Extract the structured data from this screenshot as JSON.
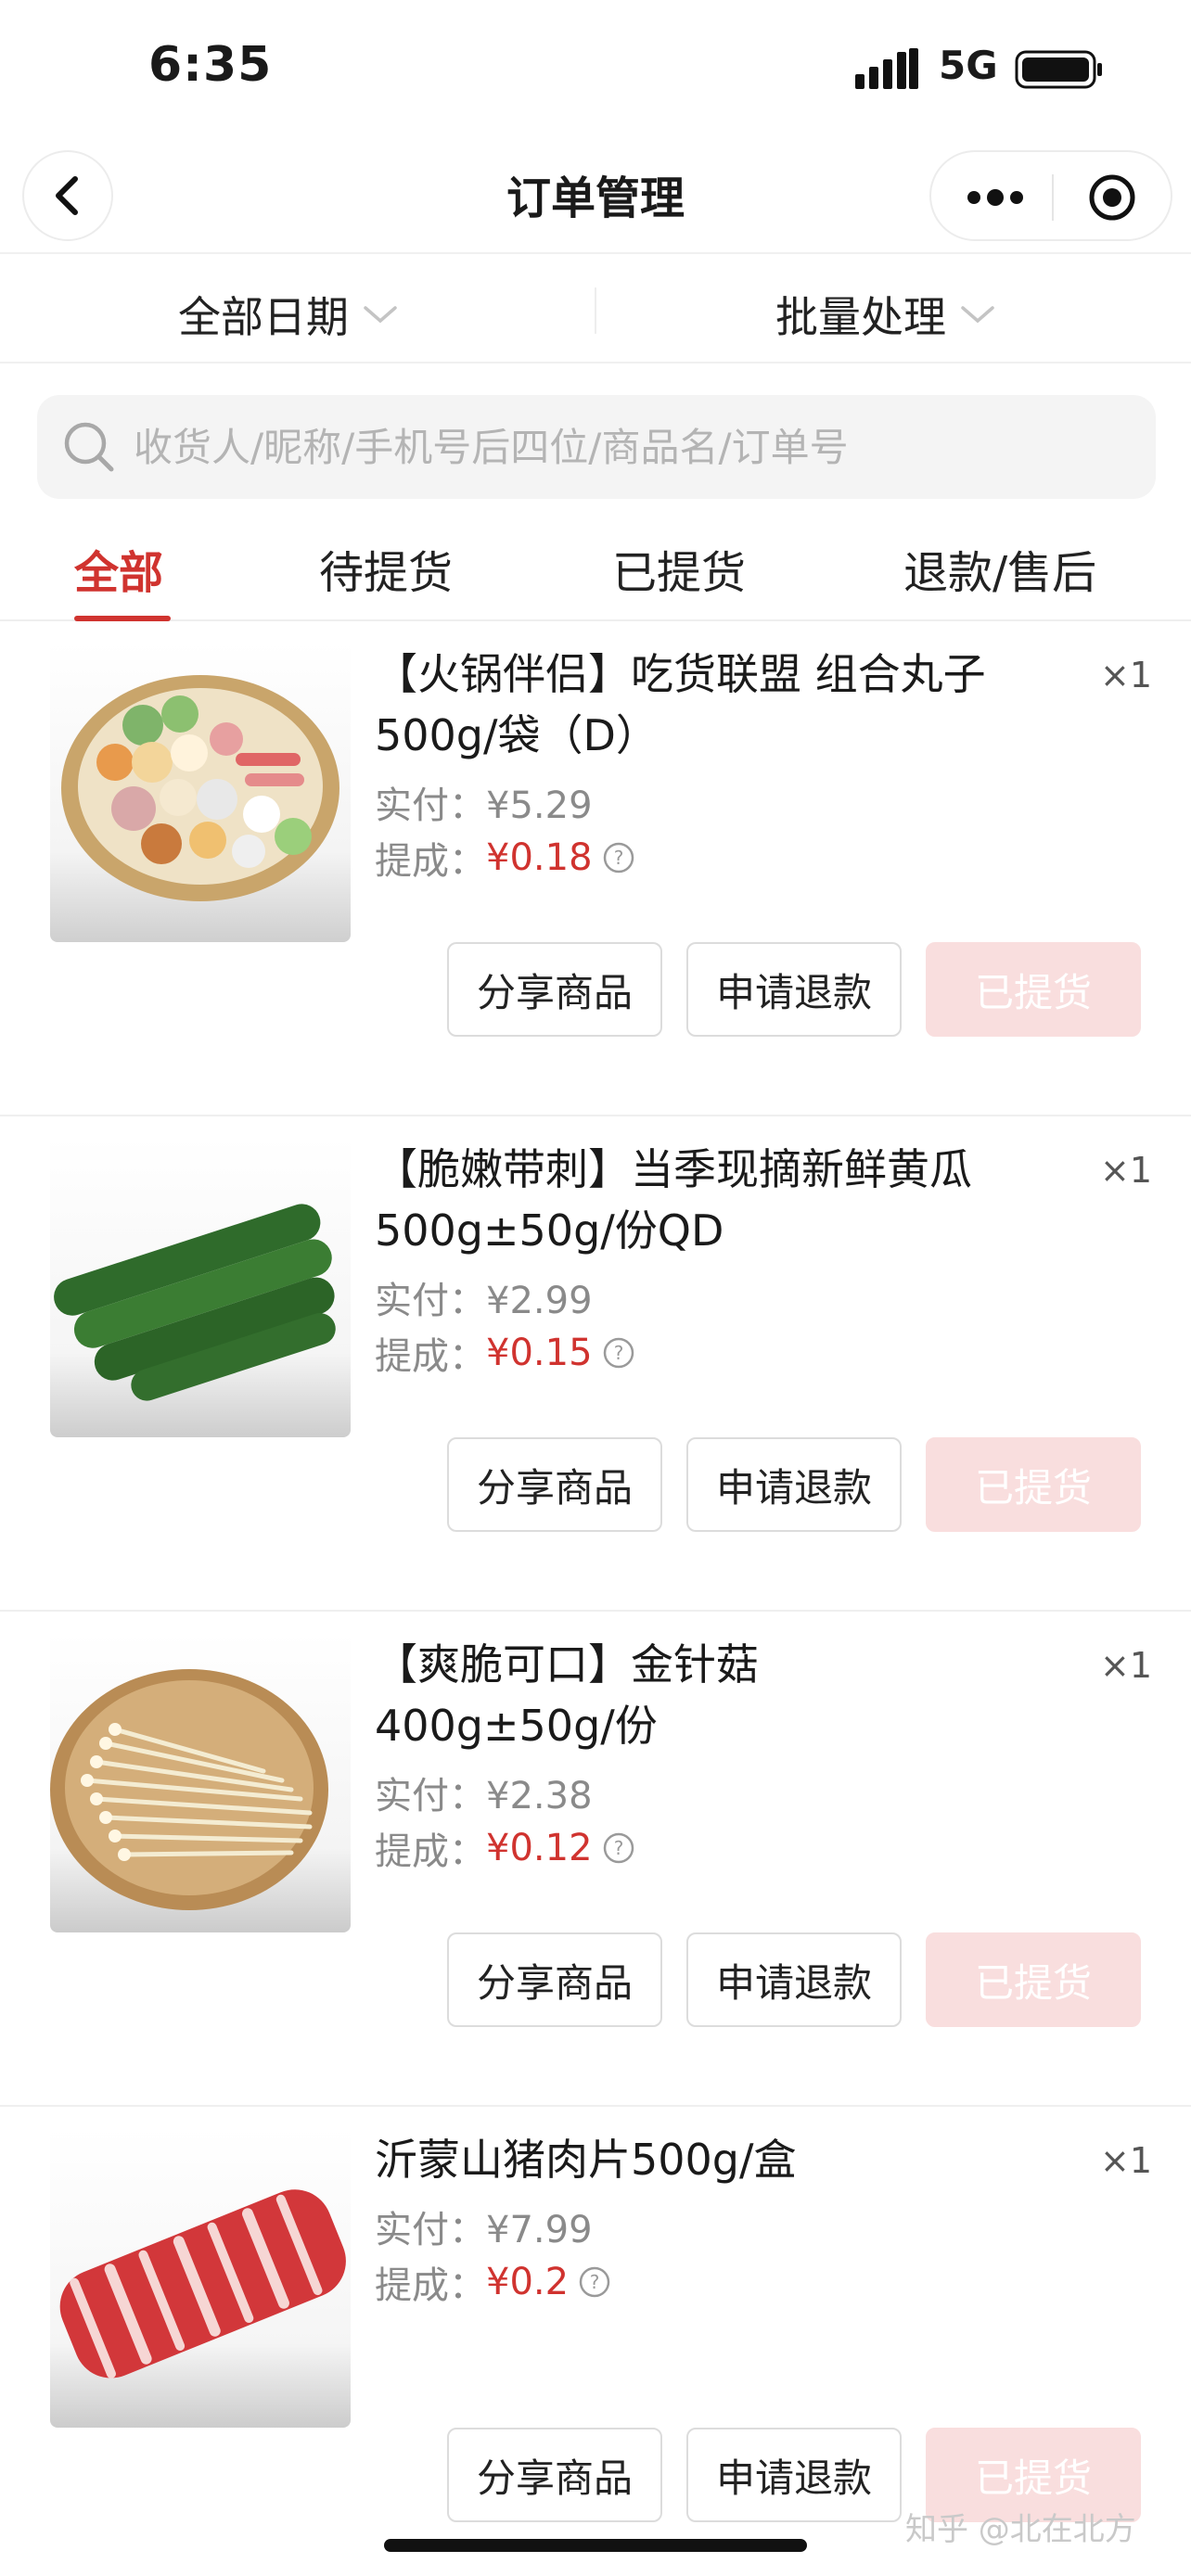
{
  "status_bar": {
    "time": "6:35",
    "network": "5G"
  },
  "nav": {
    "title": "订单管理"
  },
  "filters": {
    "date_label": "全部日期",
    "batch_label": "批量处理"
  },
  "search": {
    "placeholder": "收货人/昵称/手机号后四位/商品名/订单号"
  },
  "tabs": [
    {
      "label": "全部",
      "active": true
    },
    {
      "label": "待提货",
      "active": false
    },
    {
      "label": "已提货",
      "active": false
    },
    {
      "label": "退款/售后",
      "active": false
    }
  ],
  "labels": {
    "paid": "实付：",
    "commission": "提成："
  },
  "buttons": {
    "share": "分享商品",
    "refund": "申请退款",
    "picked": "已提货"
  },
  "orders": [
    {
      "title": "【火锅伴侣】吃货联盟 组合丸子500g/袋（D）",
      "qty": "×1",
      "paid": "¥5.29",
      "commission": "¥0.18",
      "image": "hotpot-balls-image"
    },
    {
      "title": "【脆嫩带刺】当季现摘新鲜黄瓜500g±50g/份QD",
      "qty": "×1",
      "paid": "¥2.99",
      "commission": "¥0.15",
      "image": "cucumber-image"
    },
    {
      "title": "【爽脆可口】金针菇\n400g±50g/份",
      "qty": "×1",
      "paid": "¥2.38",
      "commission": "¥0.12",
      "image": "enoki-image"
    },
    {
      "title": "沂蒙山猪肉片500g/盒",
      "qty": "×1",
      "paid": "¥7.99",
      "commission": "¥0.2",
      "image": "pork-slices-image"
    }
  ],
  "watermark": "知乎 @北在北方",
  "colors": {
    "accent": "#d0332f",
    "picked_bg": "#f9dede"
  }
}
